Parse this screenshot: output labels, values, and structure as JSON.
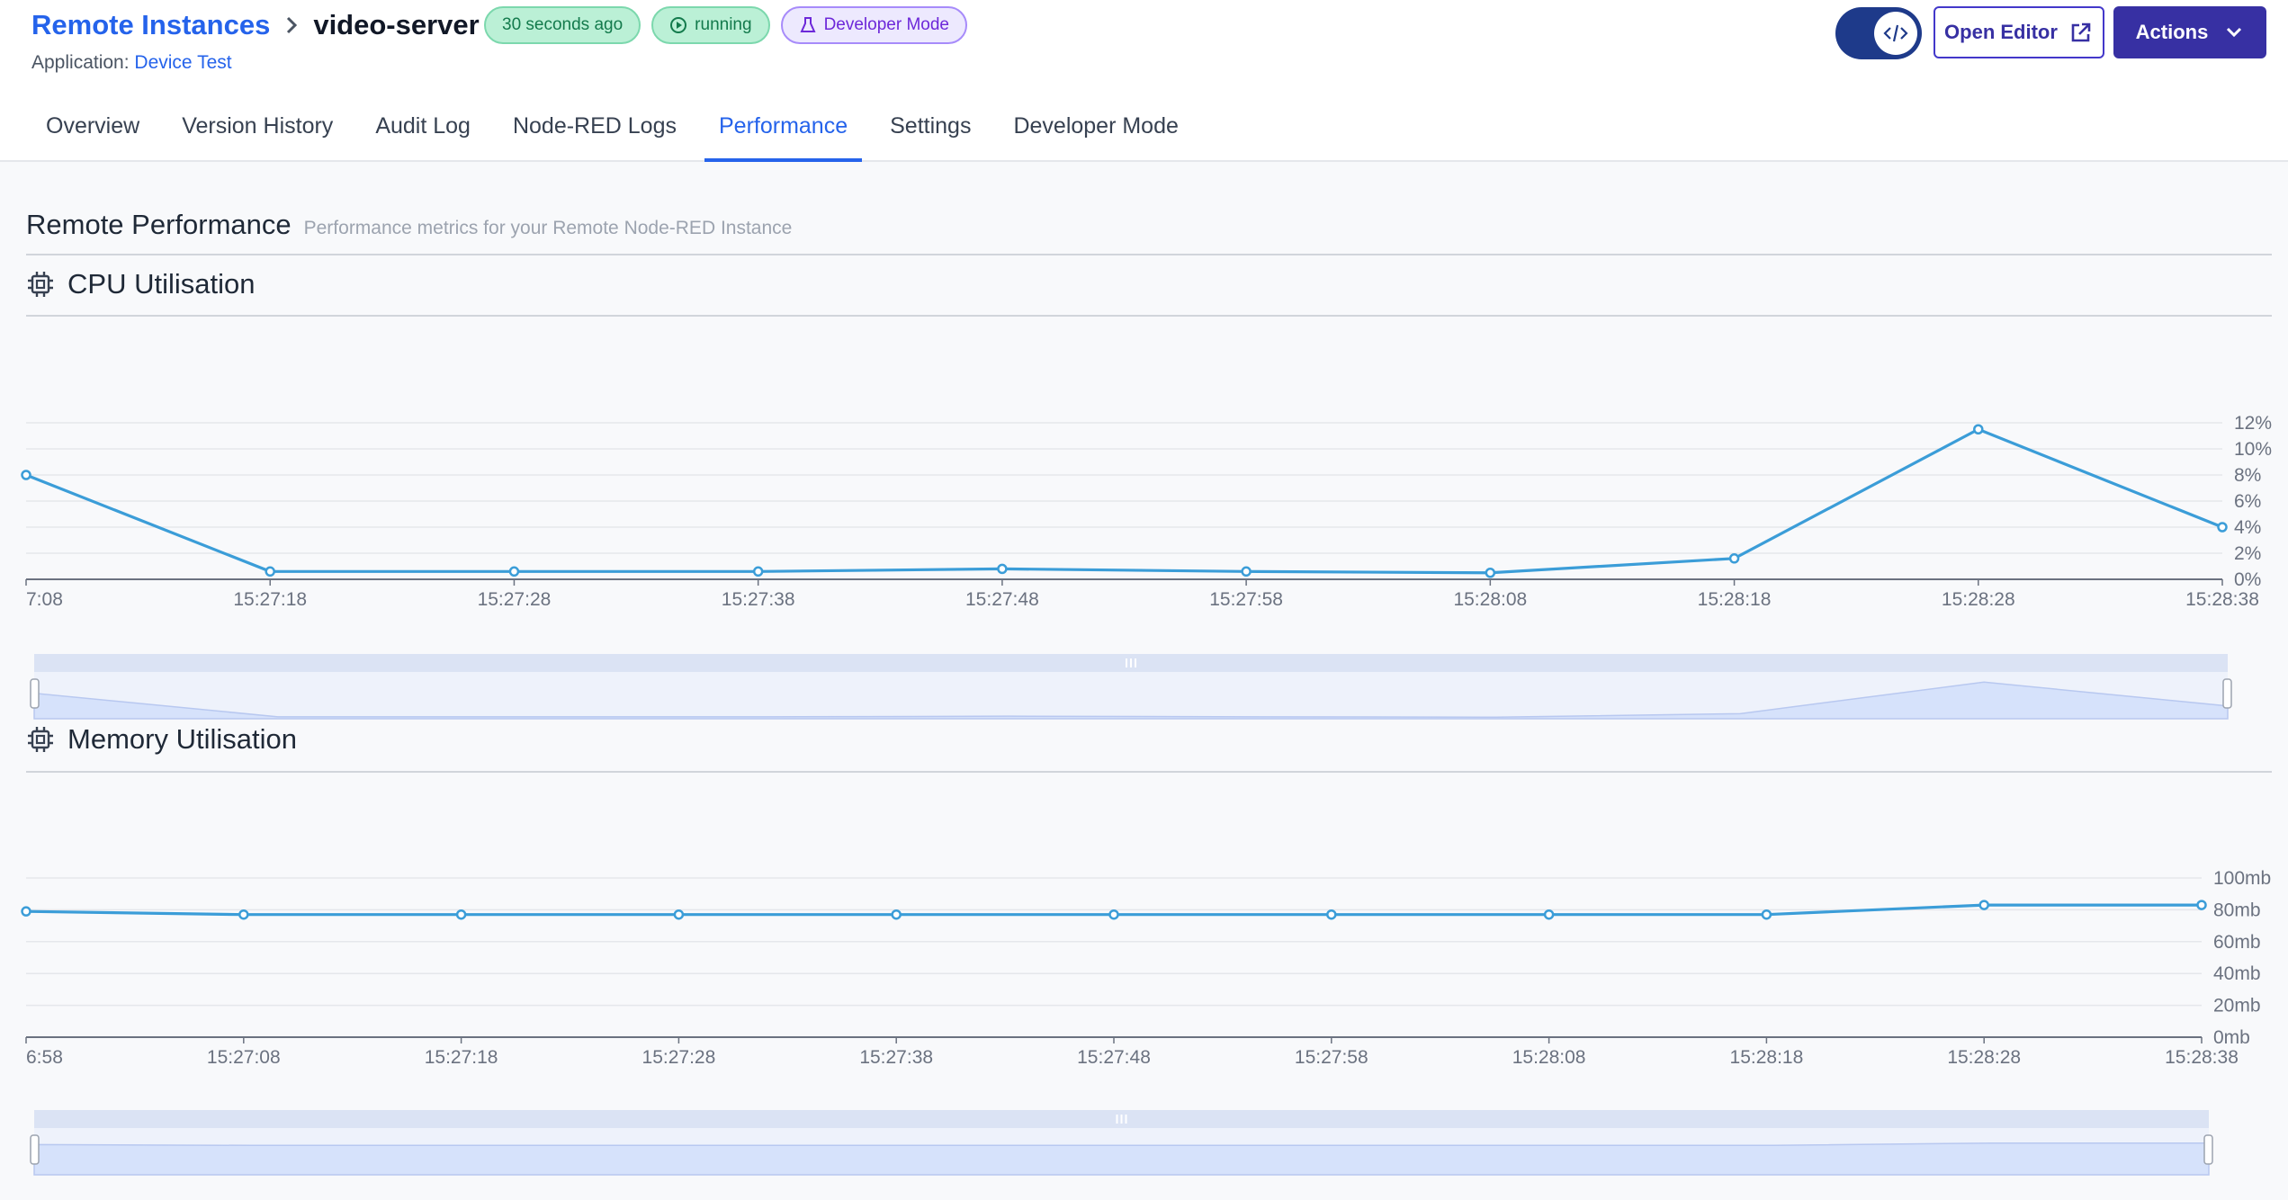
{
  "header": {
    "breadcrumb_root": "Remote Instances",
    "breadcrumb_current": "video-server",
    "badges": {
      "time": "30 seconds ago",
      "running": "running",
      "developer": "Developer Mode"
    },
    "application_label": "Application:",
    "application_name": "Device Test",
    "open_editor": "Open Editor",
    "actions": "Actions"
  },
  "tabs": [
    {
      "label": "Overview"
    },
    {
      "label": "Version History"
    },
    {
      "label": "Audit Log"
    },
    {
      "label": "Node-RED Logs"
    },
    {
      "label": "Performance",
      "active": true
    },
    {
      "label": "Settings"
    },
    {
      "label": "Developer Mode"
    }
  ],
  "section": {
    "title": "Remote Performance",
    "subtitle": "Performance metrics for your Remote Node-RED Instance"
  },
  "colors": {
    "accent": "#2563eb",
    "series": "#3b9dd8",
    "slider_fill": "#d6e2fb"
  },
  "chart_data": [
    {
      "type": "line",
      "title": "CPU Utilisation",
      "icon": "cpu-icon",
      "x": [
        "7:08",
        "15:27:18",
        "15:27:28",
        "15:27:38",
        "15:27:48",
        "15:27:58",
        "15:28:08",
        "15:28:18",
        "15:28:28",
        "15:28:38"
      ],
      "values": [
        8.0,
        0.6,
        0.6,
        0.6,
        0.8,
        0.6,
        0.5,
        1.6,
        11.5,
        4.0
      ],
      "y_ticks": [
        "0%",
        "2%",
        "4%",
        "6%",
        "8%",
        "10%",
        "12%"
      ],
      "ylim": [
        0,
        12
      ],
      "grid": true,
      "y_axis_position": "right",
      "has_zoom_slider": true
    },
    {
      "type": "line",
      "title": "Memory Utilisation",
      "icon": "memory-icon",
      "x": [
        "6:58",
        "15:27:08",
        "15:27:18",
        "15:27:28",
        "15:27:38",
        "15:27:48",
        "15:27:58",
        "15:28:08",
        "15:28:18",
        "15:28:28",
        "15:28:38"
      ],
      "values": [
        79,
        77,
        77,
        77,
        77,
        77,
        77,
        77,
        77,
        83,
        83
      ],
      "y_ticks": [
        "0mb",
        "20mb",
        "40mb",
        "60mb",
        "80mb",
        "100mb"
      ],
      "ylim": [
        0,
        100
      ],
      "grid": true,
      "y_axis_position": "right",
      "has_zoom_slider": true
    }
  ]
}
